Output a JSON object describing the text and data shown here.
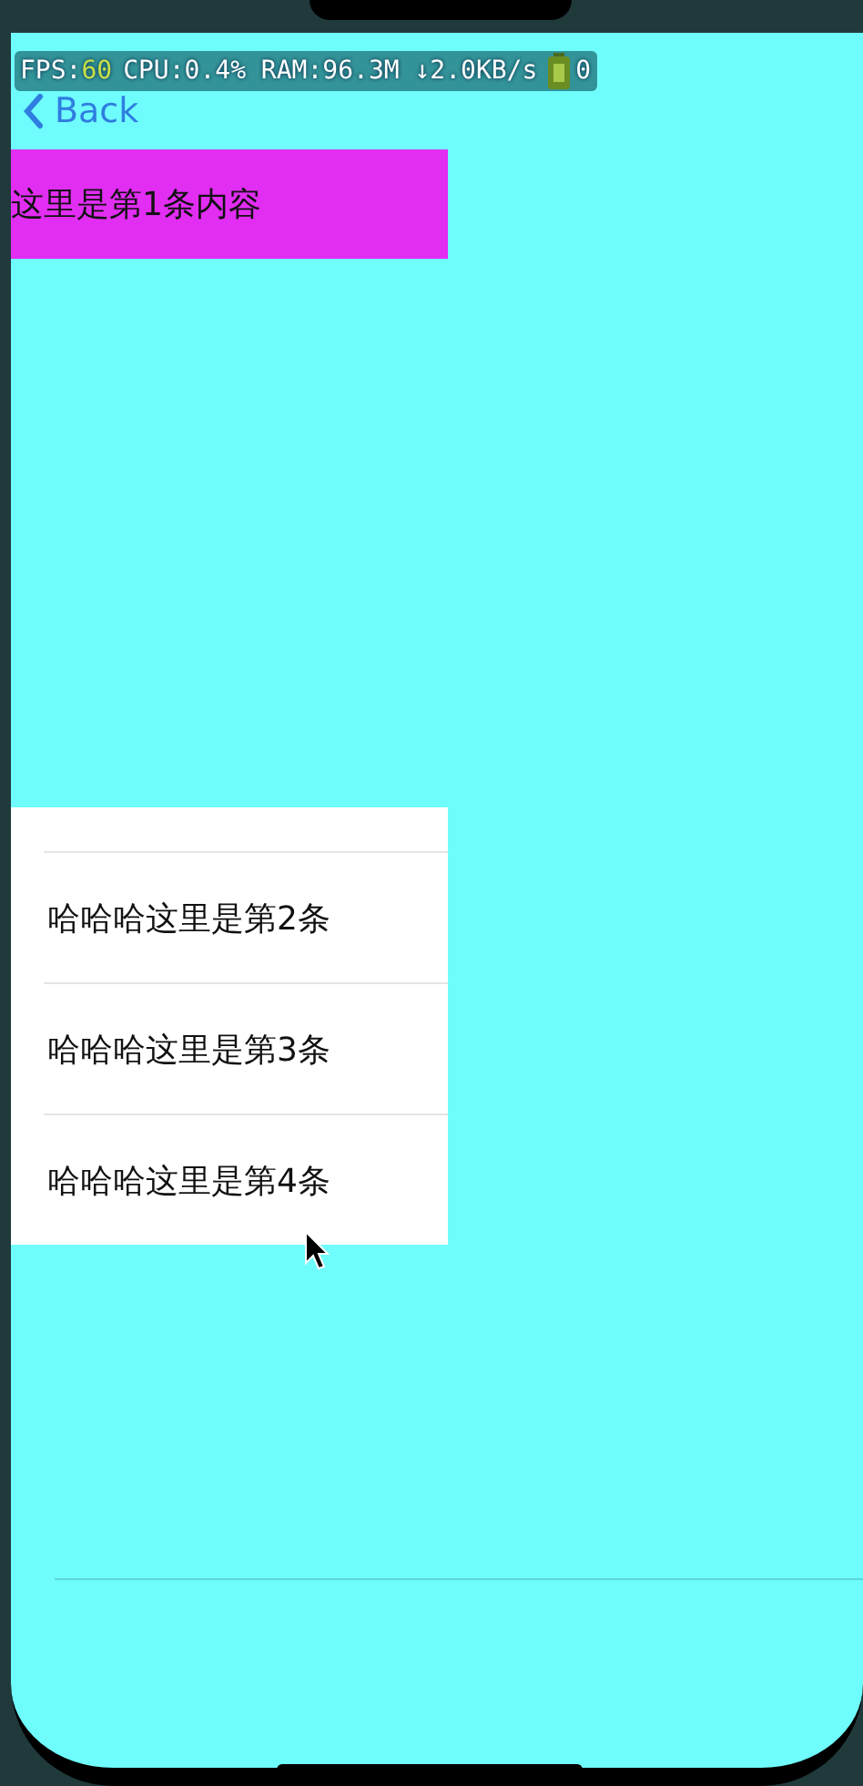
{
  "nav": {
    "back": "Back"
  },
  "perf": {
    "fps_label": "FPS:",
    "fps": "60",
    "stats": "CPU:0.4% RAM:96.3M ↓2.0KB/s",
    "battery": "0"
  },
  "banner": {
    "text": "这里是第1条内容"
  },
  "list": {
    "items": [
      {
        "text": "哈哈哈这里是第2条"
      },
      {
        "text": "哈哈哈这里是第3条"
      },
      {
        "text": "哈哈哈这里是第4条"
      }
    ]
  }
}
